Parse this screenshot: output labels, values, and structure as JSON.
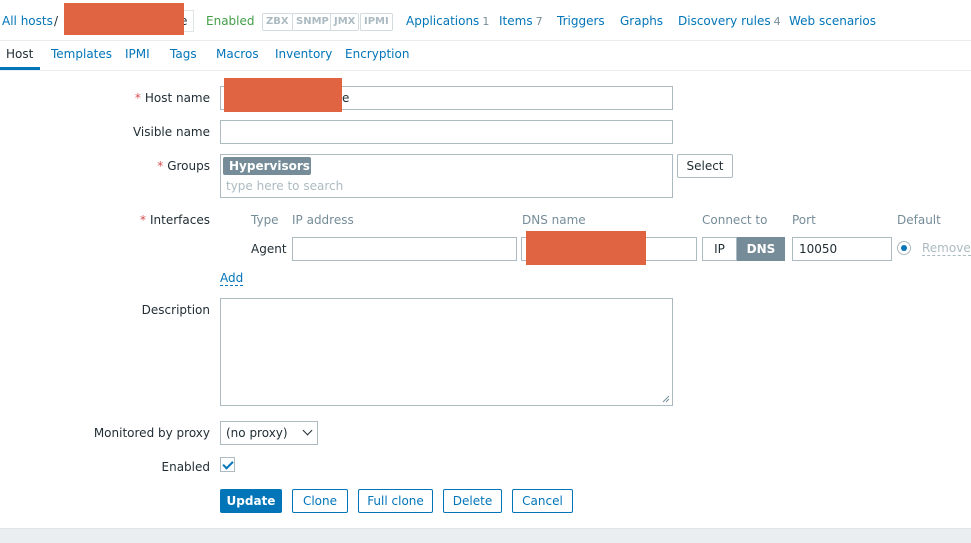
{
  "topnav": {
    "all_hosts": "All hosts",
    "separator": "/",
    "host_suffix": "e",
    "status": "Enabled",
    "availability": [
      "ZBX",
      "SNMP",
      "JMX",
      "IPMI"
    ],
    "links": [
      {
        "label": "Applications",
        "count": "1"
      },
      {
        "label": "Items",
        "count": "7"
      },
      {
        "label": "Triggers",
        "count": ""
      },
      {
        "label": "Graphs",
        "count": ""
      },
      {
        "label": "Discovery rules",
        "count": "4"
      },
      {
        "label": "Web scenarios",
        "count": ""
      }
    ]
  },
  "tabs": [
    "Host",
    "Templates",
    "IPMI",
    "Tags",
    "Macros",
    "Inventory",
    "Encryption"
  ],
  "form": {
    "host_name_label": "Host name",
    "host_name_suffix": "e",
    "visible_name_label": "Visible name",
    "visible_name_value": "",
    "groups_label": "Groups",
    "group_chip": "Hypervisors",
    "group_chip_remove": "✕",
    "groups_placeholder": "type here to search",
    "select_button": "Select",
    "interfaces_label": "Interfaces",
    "interface_columns": {
      "type": "Type",
      "ip": "IP address",
      "dns": "DNS name",
      "connect": "Connect to",
      "port": "Port",
      "default": "Default"
    },
    "interface_row": {
      "type": "Agent",
      "ip": "",
      "connect_ip": "IP",
      "connect_dns": "DNS",
      "port": "10050",
      "remove": "Remove"
    },
    "add_link": "Add",
    "description_label": "Description",
    "description_value": "",
    "proxy_label": "Monitored by proxy",
    "proxy_value": "(no proxy)",
    "enabled_label": "Enabled",
    "enabled_checked": true,
    "required_mark": "*"
  },
  "buttons": {
    "update": "Update",
    "clone": "Clone",
    "full_clone": "Full clone",
    "delete": "Delete",
    "cancel": "Cancel"
  },
  "colors": {
    "accent": "#0275b8",
    "enabled": "#429e47",
    "redaction": "#e06342",
    "chip": "#768d99"
  }
}
